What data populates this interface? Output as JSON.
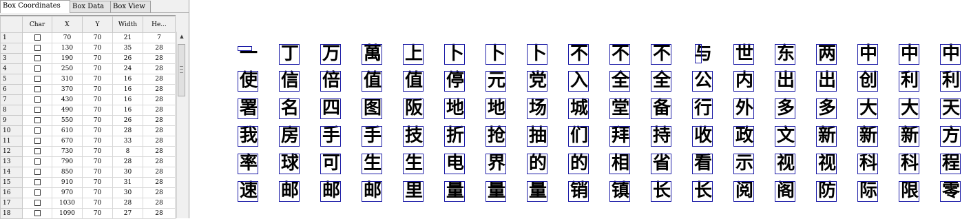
{
  "tabs": [
    "Box Coordinates",
    "Box Data",
    "Box View"
  ],
  "active_tab": 0,
  "table": {
    "headers": [
      "",
      "Char",
      "X",
      "Y",
      "Width",
      "He..."
    ],
    "rows": [
      [
        "1",
        "70",
        "70",
        "21",
        "7"
      ],
      [
        "2",
        "130",
        "70",
        "35",
        "28"
      ],
      [
        "3",
        "190",
        "70",
        "26",
        "28"
      ],
      [
        "4",
        "250",
        "70",
        "24",
        "28"
      ],
      [
        "5",
        "310",
        "70",
        "16",
        "28"
      ],
      [
        "6",
        "370",
        "70",
        "16",
        "28"
      ],
      [
        "7",
        "430",
        "70",
        "16",
        "28"
      ],
      [
        "8",
        "490",
        "70",
        "16",
        "28"
      ],
      [
        "9",
        "550",
        "70",
        "26",
        "28"
      ],
      [
        "10",
        "610",
        "70",
        "28",
        "28"
      ],
      [
        "11",
        "670",
        "70",
        "33",
        "28"
      ],
      [
        "12",
        "730",
        "70",
        "8",
        "28"
      ],
      [
        "13",
        "790",
        "70",
        "28",
        "28"
      ],
      [
        "14",
        "850",
        "70",
        "30",
        "28"
      ],
      [
        "15",
        "910",
        "70",
        "31",
        "28"
      ],
      [
        "16",
        "970",
        "70",
        "30",
        "28"
      ],
      [
        "17",
        "1030",
        "70",
        "28",
        "28"
      ],
      [
        "18",
        "1090",
        "70",
        "27",
        "28"
      ]
    ]
  },
  "box_view": {
    "glyph_rows": [
      [
        "一",
        "丁",
        "万",
        "萬",
        "上",
        "卜",
        "卜",
        "卜",
        "不",
        "不",
        "不",
        "与",
        "世",
        "东",
        "两",
        "中",
        "中",
        "中"
      ],
      [
        "使",
        "信",
        "倍",
        "值",
        "值",
        "停",
        "元",
        "党",
        "入",
        "全",
        "全",
        "公",
        "内",
        "出",
        "出",
        "创",
        "利",
        "利"
      ],
      [
        "署",
        "名",
        "四",
        "图",
        "阪",
        "地",
        "地",
        "场",
        "城",
        "堂",
        "备",
        "行",
        "外",
        "多",
        "多",
        "大",
        "大",
        "天"
      ],
      [
        "我",
        "房",
        "手",
        "手",
        "技",
        "折",
        "抢",
        "抽",
        "们",
        "拜",
        "持",
        "收",
        "政",
        "文",
        "新",
        "新",
        "新",
        "方"
      ],
      [
        "率",
        "球",
        "可",
        "生",
        "生",
        "电",
        "界",
        "的",
        "的",
        "相",
        "省",
        "看",
        "示",
        "视",
        "视",
        "科",
        "科",
        "程"
      ],
      [
        "速",
        "邮",
        "邮",
        "邮",
        "里",
        "量",
        "量",
        "量",
        "销",
        "镇",
        "长",
        "长",
        "阅",
        "阁",
        "防",
        "际",
        "限",
        "零"
      ]
    ],
    "box_color": "#1a1aa6"
  }
}
